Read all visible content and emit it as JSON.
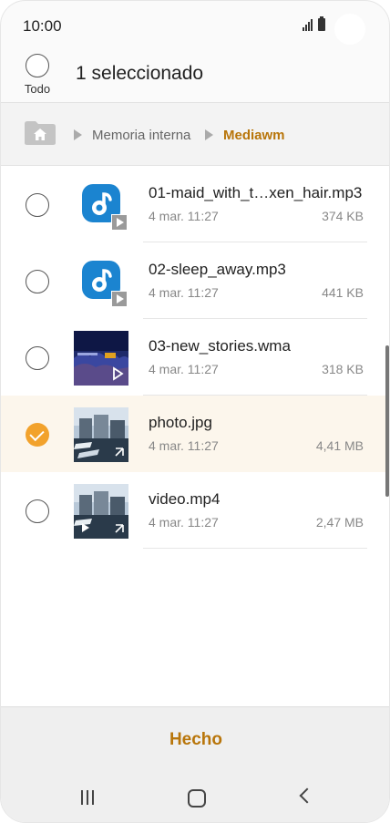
{
  "status_bar": {
    "time": "10:00"
  },
  "header": {
    "select_all_label": "Todo",
    "title": "1 seleccionado"
  },
  "breadcrumb": {
    "items": [
      "Memoria interna",
      "Mediawm"
    ]
  },
  "files": [
    {
      "name": "01-maid_with_t…xen_hair.mp3",
      "date": "4 mar. 11:27",
      "size": "374 KB",
      "type": "audio",
      "selected": false
    },
    {
      "name": "02-sleep_away.mp3",
      "date": "4 mar. 11:27",
      "size": "441 KB",
      "type": "audio",
      "selected": false
    },
    {
      "name": "03-new_stories.wma",
      "date": "4 mar. 11:27",
      "size": "318 KB",
      "type": "audio-album",
      "selected": false
    },
    {
      "name": "photo.jpg",
      "date": "4 mar. 11:27",
      "size": "4,41 MB",
      "type": "image",
      "selected": true
    },
    {
      "name": "video.mp4",
      "date": "4 mar. 11:27",
      "size": "2,47 MB",
      "type": "video",
      "selected": false
    }
  ],
  "footer": {
    "done_label": "Hecho"
  },
  "colors": {
    "accent": "#f2a22c",
    "accent_text": "#b8750a",
    "music_icon": "#1b84d0",
    "selected_row": "#fcf6ec"
  }
}
